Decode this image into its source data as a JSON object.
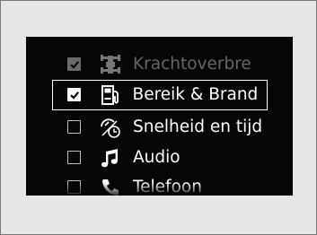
{
  "menu": {
    "items": [
      {
        "label": "Krachtoverbre",
        "checked": true,
        "state": "dimmed",
        "icon": "drivetrain-icon"
      },
      {
        "label": "Bereik & Brand",
        "checked": true,
        "state": "selected",
        "icon": "fuel-pump-icon"
      },
      {
        "label": "Snelheid en tijd",
        "checked": false,
        "state": "normal",
        "icon": "speed-time-icon"
      },
      {
        "label": "Audio",
        "checked": false,
        "state": "normal",
        "icon": "music-note-icon"
      },
      {
        "label": "Telefoon",
        "checked": false,
        "state": "partially-visible",
        "icon": "phone-icon"
      }
    ]
  },
  "colors": {
    "background": "#060606",
    "text": "#ffffff",
    "dimmed": "#666666",
    "frame": "#e6e6e6"
  }
}
